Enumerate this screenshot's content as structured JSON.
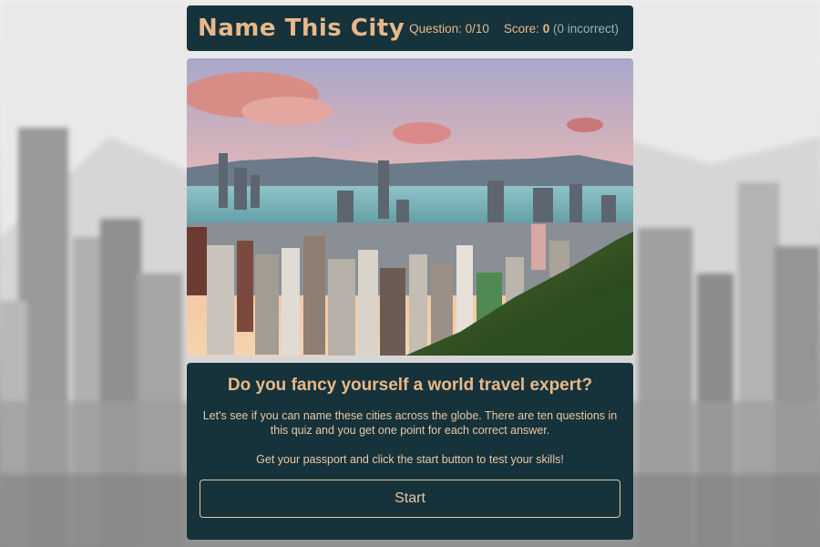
{
  "header": {
    "title": "Name This City",
    "question_label": "Question:",
    "question_value": "0/10",
    "score_label": "Score:",
    "score_value": "0",
    "incorrect_text": "(0 incorrect)"
  },
  "intro": {
    "heading": "Do you fancy yourself a world travel expert?",
    "paragraph_1": "Let's see if you can name these cities across the globe. There are ten questions in this quiz and you get one point for each correct answer.",
    "paragraph_2": "Get your passport and click the start button to test your skills!",
    "start_label": "Start"
  },
  "colors": {
    "panel": "#16323a",
    "accent": "#e7b98a",
    "muted": "#9fb2b4"
  }
}
